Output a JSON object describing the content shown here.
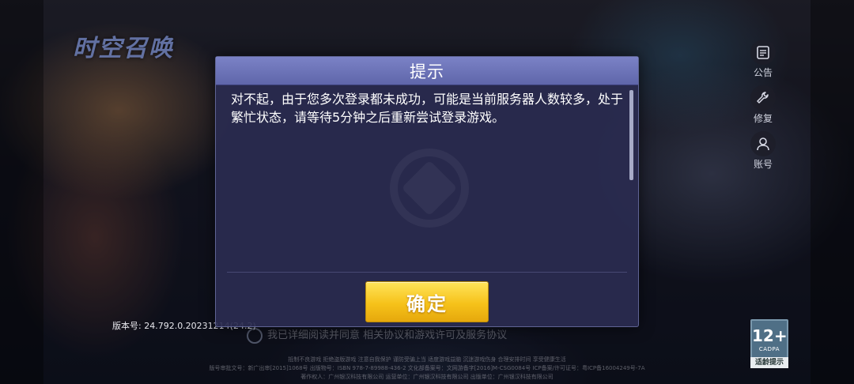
{
  "background": {
    "logo_text": "时空召唤"
  },
  "side_buttons": [
    {
      "label": "公告",
      "icon": "notice-icon"
    },
    {
      "label": "修复",
      "icon": "wrench-icon"
    },
    {
      "label": "账号",
      "icon": "user-icon"
    }
  ],
  "version_text": "版本号: 24.792.0.20231214(24.2)",
  "dialog": {
    "title": "提示",
    "message": "对不起，由于您多次登录都未成功，可能是当前服务器人数较多，处于繁忙状态，请等待5分钟之后重新尝试登录游戏。",
    "confirm_label": "确定"
  },
  "footer": {
    "agreement": "我已详细阅读并同意 相关协议和游戏许可及服务协议",
    "lines": [
      "抵制不良游戏   拒绝盗版游戏   注意自我保护   谨防受骗上当   适度游戏益脑   沉迷游戏伤身   合理安排时间   享受健康生活",
      "版号审批文号：新广出审[2015]1068号   出版物号：ISBN 978-7-89988-436-2   文化部备案号：文网游备字[2016]M-CSG0084号   ICP备案/许可证号：粤ICP备16004249号-7A",
      "著作权人：广州银汉科技有限公司   运营单位：广州银汉科技有限公司   出版单位：广州银汉科技有限公司"
    ]
  },
  "age_rating": {
    "number": "12+",
    "org": "CADPA",
    "tip": "适龄提示"
  },
  "colors": {
    "dialog_header": "#6b72b8",
    "confirm_button": "#f6c21a",
    "dialog_body": "#2a2b50"
  }
}
